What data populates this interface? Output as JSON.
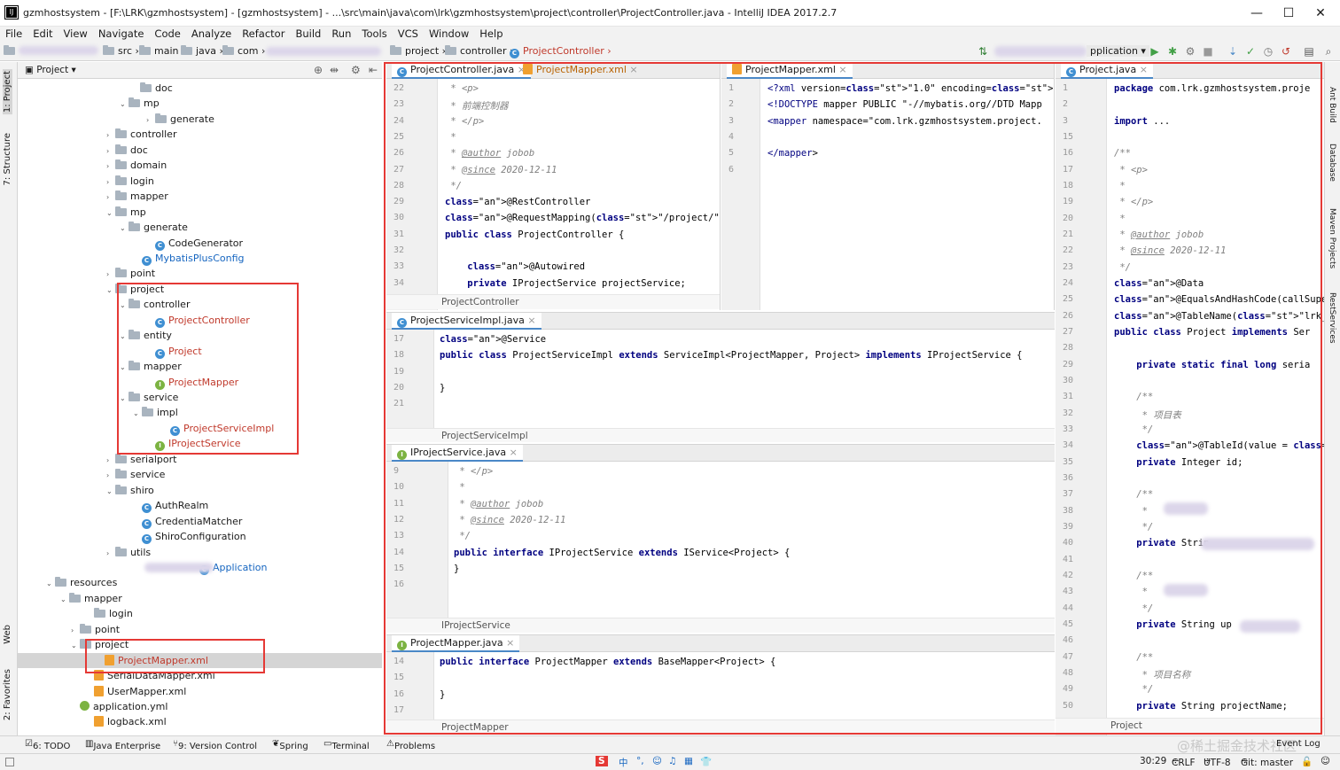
{
  "window": {
    "title": "gzmhostsystem - [F:\\LRK\\gzmhostsystem] - [gzmhostsystem] - ...\\src\\main\\java\\com\\lrk\\gzmhostsystem\\project\\controller\\ProjectController.java - IntelliJ IDEA 2017.2.7"
  },
  "menu": [
    "File",
    "Edit",
    "View",
    "Navigate",
    "Code",
    "Analyze",
    "Refactor",
    "Build",
    "Run",
    "Tools",
    "VCS",
    "Window",
    "Help"
  ],
  "nav": {
    "crumbs": [
      "src",
      "main",
      "java",
      "com",
      "project",
      "controller",
      "ProjectController"
    ],
    "run_config": "pplication"
  },
  "project_panel": {
    "title": "Project"
  },
  "tree": [
    {
      "label": "doc",
      "kind": "folder"
    },
    {
      "label": "mp",
      "kind": "folder"
    },
    {
      "label": "generate",
      "kind": "folder"
    },
    {
      "label": "controller",
      "kind": "folder"
    },
    {
      "label": "doc",
      "kind": "folder"
    },
    {
      "label": "domain",
      "kind": "folder"
    },
    {
      "label": "login",
      "kind": "folder"
    },
    {
      "label": "mapper",
      "kind": "folder"
    },
    {
      "label": "mp",
      "kind": "folder"
    },
    {
      "label": "generate",
      "kind": "folder"
    },
    {
      "label": "CodeGenerator",
      "kind": "class"
    },
    {
      "label": "MybatisPlusConfig",
      "kind": "class"
    },
    {
      "label": "point",
      "kind": "folder"
    },
    {
      "label": "project",
      "kind": "folder"
    },
    {
      "label": "controller",
      "kind": "folder"
    },
    {
      "label": "ProjectController",
      "kind": "class"
    },
    {
      "label": "entity",
      "kind": "folder"
    },
    {
      "label": "Project",
      "kind": "class"
    },
    {
      "label": "mapper",
      "kind": "folder"
    },
    {
      "label": "ProjectMapper",
      "kind": "interface"
    },
    {
      "label": "service",
      "kind": "folder"
    },
    {
      "label": "impl",
      "kind": "folder"
    },
    {
      "label": "ProjectServiceImpl",
      "kind": "class"
    },
    {
      "label": "IProjectService",
      "kind": "interface"
    },
    {
      "label": "serialport",
      "kind": "folder"
    },
    {
      "label": "service",
      "kind": "folder"
    },
    {
      "label": "shiro",
      "kind": "folder"
    },
    {
      "label": "AuthRealm",
      "kind": "class"
    },
    {
      "label": "CredentiaMatcher",
      "kind": "class"
    },
    {
      "label": "ShiroConfiguration",
      "kind": "class"
    },
    {
      "label": "utils",
      "kind": "folder"
    },
    {
      "label": "Application",
      "kind": "class"
    },
    {
      "label": "resources",
      "kind": "folder"
    },
    {
      "label": "mapper",
      "kind": "folder"
    },
    {
      "label": "login",
      "kind": "folder"
    },
    {
      "label": "point",
      "kind": "folder"
    },
    {
      "label": "project",
      "kind": "folder"
    },
    {
      "label": "ProjectMapper.xml",
      "kind": "xml"
    },
    {
      "label": "SerialDataMapper.xml",
      "kind": "xml"
    },
    {
      "label": "UserMapper.xml",
      "kind": "xml"
    },
    {
      "label": "application.yml",
      "kind": "yml"
    },
    {
      "label": "logback.xml",
      "kind": "xml"
    }
  ],
  "editors": {
    "controller": {
      "tabs": [
        "ProjectController.java",
        "ProjectMapper.xml"
      ],
      "crumb": "ProjectController",
      "lines": [
        "22",
        "23",
        "24",
        "25",
        "26",
        "27",
        "28",
        "29",
        "30",
        "31",
        "32",
        "33",
        "34"
      ],
      "code": [
        " * <p>",
        " * 前端控制器",
        " * </p>",
        " *",
        " * @author jobob",
        " * @since 2020-12-11",
        " */",
        "@RestController",
        "@RequestMapping(\"/project/\")",
        "public class ProjectController {",
        "",
        "    @Autowired",
        "    private IProjectService projectService;"
      ]
    },
    "mapperxml": {
      "tabs": [
        "ProjectMapper.xml"
      ],
      "lines": [
        "1",
        "2",
        "3",
        "4",
        "5",
        "6"
      ],
      "code": [
        "<?xml version=\"1.0\" encoding=\"UTF-8\"?>",
        "<!DOCTYPE mapper PUBLIC \"-//mybatis.org//DTD Mapp",
        "<mapper namespace=\"com.lrk.gzmhostsystem.project.",
        "",
        "</mapper>",
        ""
      ]
    },
    "entity": {
      "tabs": [
        "Project.java"
      ],
      "crumb": "Project",
      "lines": [
        "1",
        "2",
        "3",
        "15",
        "16",
        "17",
        "18",
        "19",
        "20",
        "21",
        "22",
        "23",
        "24",
        "25",
        "26",
        "27",
        "28",
        "29",
        "30",
        "31",
        "32",
        "33",
        "34",
        "35",
        "36",
        "37",
        "38",
        "39",
        "40",
        "41",
        "42",
        "43",
        "44",
        "45",
        "46",
        "47",
        "48",
        "49",
        "50"
      ],
      "code": [
        "package com.lrk.gzmhostsystem.proje",
        "",
        "import ...",
        "",
        "/**",
        " * <p>",
        " *",
        " * </p>",
        " *",
        " * @author jobob",
        " * @since 2020-12-11",
        " */",
        "@Data",
        "@EqualsAndHashCode(callSuper = false",
        "@TableName(\"lrk_project\")",
        "public class Project implements Ser",
        "",
        "    private static final long seria",
        "",
        "    /**",
        "     * 项目表",
        "     */",
        "    @TableId(value = \"id\", type = Id",
        "    private Integer id;",
        "",
        "    /**",
        "     *",
        "     */",
        "    private Strin",
        "",
        "    /**",
        "     *",
        "     */",
        "    private String up",
        "",
        "    /**",
        "     * 项目名称",
        "     */",
        "    private String projectName;"
      ]
    },
    "serviceimpl": {
      "tabs": [
        "ProjectServiceImpl.java"
      ],
      "crumb": "ProjectServiceImpl",
      "lines": [
        "17",
        "18",
        "19",
        "20",
        "21"
      ],
      "code": [
        "@Service",
        "public class ProjectServiceImpl extends ServiceImpl<ProjectMapper, Project> implements IProjectService {",
        "",
        "}",
        ""
      ]
    },
    "iservice": {
      "tabs": [
        "IProjectService.java"
      ],
      "crumb": "IProjectService",
      "lines": [
        "9",
        "10",
        "11",
        "12",
        "13",
        "14",
        "15",
        "16"
      ],
      "code": [
        " * </p>",
        " *",
        " * @author jobob",
        " * @since 2020-12-11",
        " */",
        "public interface IProjectService extends IService<Project> {",
        "}",
        ""
      ]
    },
    "mapper": {
      "tabs": [
        "ProjectMapper.java"
      ],
      "crumb": "ProjectMapper",
      "lines": [
        "14",
        "15",
        "16",
        "17"
      ],
      "code": [
        "public interface ProjectMapper extends BaseMapper<Project> {",
        "",
        "}",
        ""
      ]
    }
  },
  "bottom_tools": [
    "6: TODO",
    "Java Enterprise",
    "9: Version Control",
    "Spring",
    "Terminal",
    "Problems"
  ],
  "event_log": "Event Log",
  "left_tools": [
    "1: Project",
    "7: Structure",
    "Web",
    "2: Favorites"
  ],
  "right_tools": [
    "Ant Build",
    "Database",
    "Maven Projects",
    "RestServices"
  ],
  "status": {
    "position": "30:29",
    "line_sep": "CRLF",
    "encoding": "UTF-8",
    "git": "Git: master",
    "watermark": "@稀土掘金技术社区"
  },
  "ime": [
    "中",
    "°,",
    "☺",
    "♫",
    "▦",
    "👕"
  ],
  "colors": {
    "highlight_red": "#e53935",
    "accent": "#4a88c7"
  }
}
